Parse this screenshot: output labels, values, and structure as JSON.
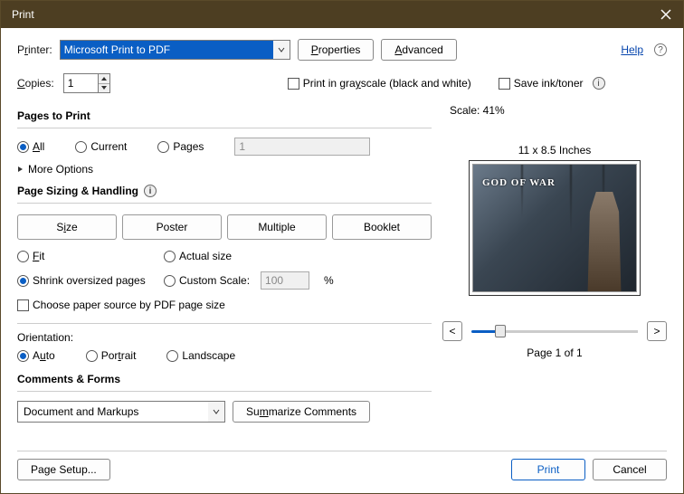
{
  "titlebar": {
    "title": "Print"
  },
  "top": {
    "printer_label_pre": "P",
    "printer_label_u": "r",
    "printer_label_post": "inter:",
    "printer_selected": "Microsoft Print to PDF",
    "properties_btn_u": "P",
    "properties_btn_post": "roperties",
    "advanced_btn_u": "A",
    "advanced_btn_post": "dvanced",
    "help_text": "Help"
  },
  "row2": {
    "copies_label_u": "C",
    "copies_label_post": "opies:",
    "copies_value": "1",
    "grayscale_label": "Print in grayscale (black and white)",
    "grayscale_u": "y",
    "saveink_label": "Save ink/toner"
  },
  "pages": {
    "title": "Pages to Print",
    "all_u": "A",
    "all_post": "ll",
    "current": "Current",
    "pages_opt": "Pages",
    "pages_value": "1",
    "more": "More Options"
  },
  "sizing": {
    "title": "Page Sizing & Handling",
    "tab_size": "Size",
    "tab_size_u": "i",
    "tab_poster": "Poster",
    "tab_multiple": "Multiple",
    "tab_booklet": "Booklet",
    "fit_u": "F",
    "fit_post": "it",
    "actual": "Actual size",
    "shrink": "Shrink oversized pages",
    "custom": "Custom Scale:",
    "custom_value": "100",
    "percent": "%",
    "choose_paper": "Choose paper source by PDF page size"
  },
  "orientation": {
    "title": "Orientation:",
    "auto_u": "u",
    "auto_pre": "A",
    "auto_post": "to",
    "portrait": "Portrait",
    "portrait_u": "t",
    "landscape": "Landscape"
  },
  "comments": {
    "title": "Comments & Forms",
    "dd_value": "Document and Markups",
    "summarize_btn": "Summarize Comments",
    "summarize_u": "m"
  },
  "preview": {
    "scale_label": "Scale:  41%",
    "dims": "11 x 8.5 Inches",
    "game_title": "GOD OF WAR",
    "page_indicator": "Page 1 of 1",
    "prev": "<",
    "next": ">"
  },
  "footer": {
    "page_setup": "Page Setup...",
    "page_setup_u": "g",
    "print_btn": "Print",
    "cancel_btn": "Cancel"
  }
}
